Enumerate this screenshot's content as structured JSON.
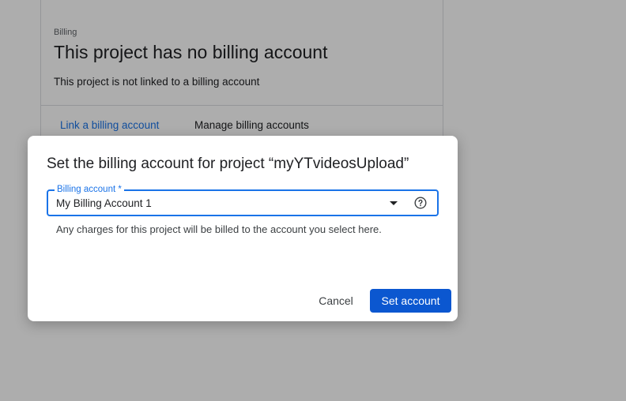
{
  "card": {
    "overline": "Billing",
    "title": "This project has no billing account",
    "description": "This project is not linked to a billing account",
    "link_action": "Link a billing account",
    "manage_action": "Manage billing accounts"
  },
  "dialog": {
    "title": "Set the billing account for project “myYTvideosUpload”",
    "field": {
      "label": "Billing account *",
      "value": "My Billing Account 1",
      "help_icon": "help-circle-icon",
      "dropdown_icon": "arrow-drop-down-icon"
    },
    "hint": "Any charges for this project will be billed to the account you select here.",
    "cancel_label": "Cancel",
    "submit_label": "Set account"
  },
  "colors": {
    "accent": "#1a73e8",
    "primary_button": "#0b57d0",
    "scrim": "rgba(0,0,0,0.32)"
  }
}
